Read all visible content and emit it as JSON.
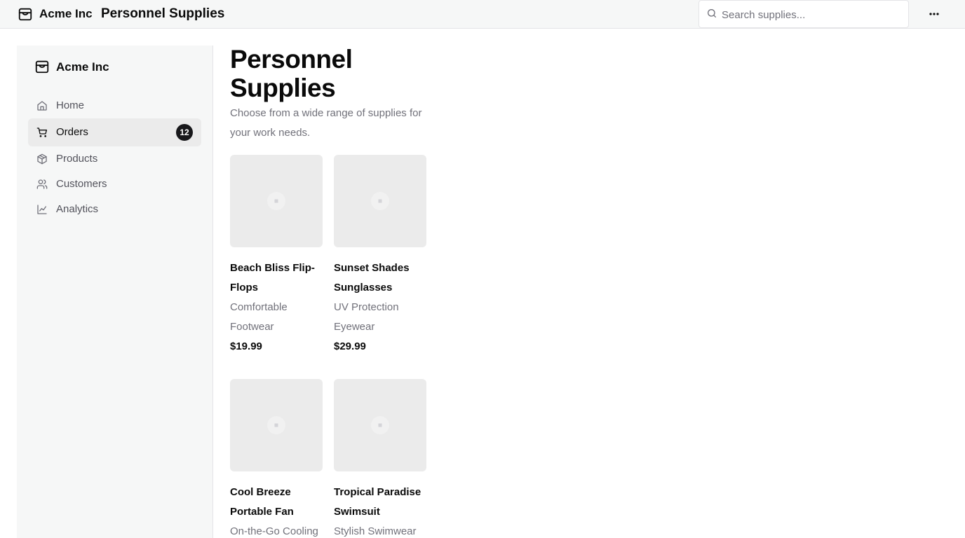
{
  "header": {
    "brand": "Acme Inc",
    "title": "Personnel Supplies",
    "search_placeholder": "Search supplies..."
  },
  "sidebar": {
    "brand": "Acme Inc",
    "items": [
      {
        "label": "Home",
        "icon": "home-icon",
        "active": false
      },
      {
        "label": "Orders",
        "icon": "shopping-cart-icon",
        "active": true,
        "badge": "12"
      },
      {
        "label": "Products",
        "icon": "package-icon",
        "active": false
      },
      {
        "label": "Customers",
        "icon": "users-icon",
        "active": false
      },
      {
        "label": "Analytics",
        "icon": "line-chart-icon",
        "active": false
      }
    ]
  },
  "main": {
    "title": "Personnel Supplies",
    "subtitle": "Choose from a wide range of supplies for your work needs.",
    "products": [
      {
        "name": "Beach Bliss Flip-Flops",
        "description": "Comfortable Footwear",
        "price": "$19.99"
      },
      {
        "name": "Sunset Shades Sunglasses",
        "description": "UV Protection Eyewear",
        "price": "$29.99"
      },
      {
        "name": "Cool Breeze Portable Fan",
        "description": "On-the-Go Cooling",
        "price": ""
      },
      {
        "name": "Tropical Paradise Swimsuit",
        "description": "Stylish Swimwear",
        "price": ""
      }
    ]
  },
  "colors": {
    "sidebar_bg": "#f6f7f7",
    "active_item_bg": "#ebebeb",
    "badge_bg": "#18181b",
    "muted_text": "#71717a",
    "placeholder_bg": "#ebebeb"
  }
}
